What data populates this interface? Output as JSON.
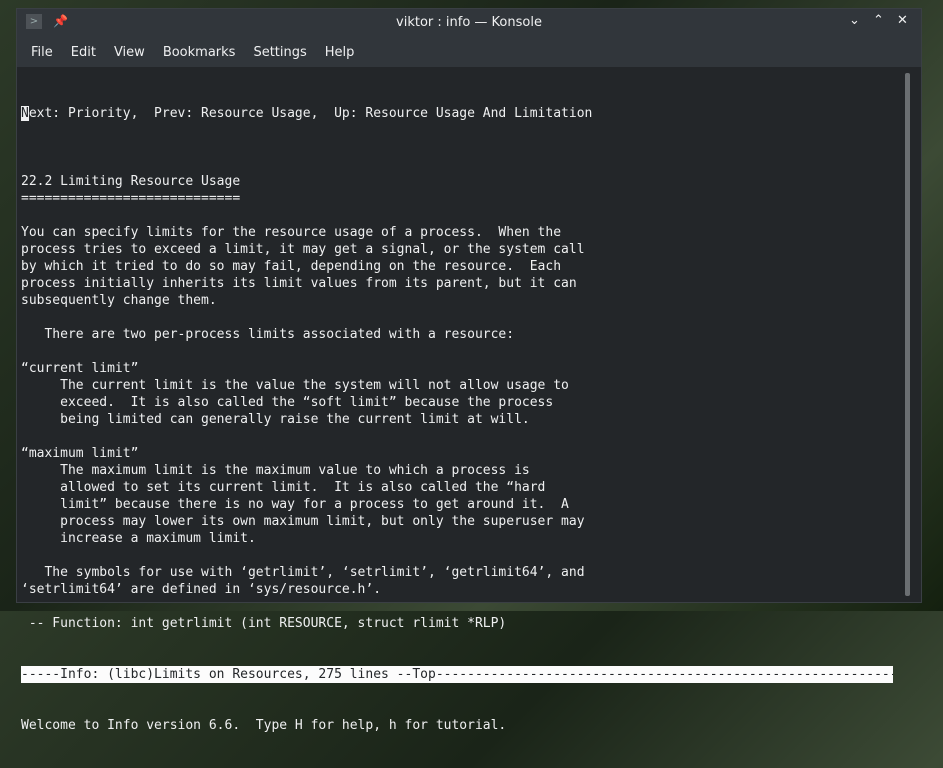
{
  "window": {
    "title": "viktor : info — Konsole"
  },
  "menu": [
    "File",
    "Edit",
    "View",
    "Bookmarks",
    "Settings",
    "Help"
  ],
  "terminal": {
    "cursor_char": "N",
    "first_line_rest": "ext: Priority,  Prev: Resource Usage,  Up: Resource Usage And Limitation",
    "lines": [
      "",
      "22.2 Limiting Resource Usage",
      "============================",
      "",
      "You can specify limits for the resource usage of a process.  When the",
      "process tries to exceed a limit, it may get a signal, or the system call",
      "by which it tried to do so may fail, depending on the resource.  Each",
      "process initially inherits its limit values from its parent, but it can",
      "subsequently change them.",
      "",
      "   There are two per-process limits associated with a resource:",
      "",
      "“current limit”",
      "     The current limit is the value the system will not allow usage to",
      "     exceed.  It is also called the “soft limit” because the process",
      "     being limited can generally raise the current limit at will.",
      "",
      "“maximum limit”",
      "     The maximum limit is the maximum value to which a process is",
      "     allowed to set its current limit.  It is also called the “hard",
      "     limit” because there is no way for a process to get around it.  A",
      "     process may lower its own maximum limit, but only the superuser may",
      "     increase a maximum limit.",
      "",
      "   The symbols for use with ‘getrlimit’, ‘setrlimit’, ‘getrlimit64’, and",
      "‘setrlimit64’ are defined in ‘sys/resource.h’.",
      "",
      " -- Function: int getrlimit (int RESOURCE, struct rlimit *RLP)"
    ],
    "status_line": "-----Info: (libc)Limits on Resources, 275 lines --Top-------------------------------------------------------------",
    "echo_line": "Welcome to Info version 6.6.  Type H for help, h for tutorial."
  }
}
